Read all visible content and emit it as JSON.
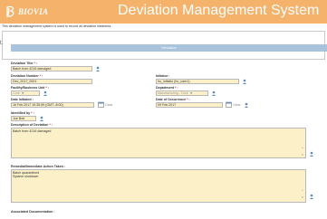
{
  "brand": {
    "logo_text": "BIOVIA"
  },
  "app": {
    "title": "Deviation Management System"
  },
  "intro_text": "This deviation management system is used to record all deviation instances.",
  "section": {
    "title": "Deviation"
  },
  "left_marker": "t.",
  "fields": {
    "deviation_title": {
      "label": "Deviation Title",
      "value": "Batch from 4216 damaged"
    },
    "deviation_number": {
      "label": "Deviation Number",
      "value": "Dev_2017_0001"
    },
    "initiator": {
      "label": "Initiator",
      "value": "hu_initiatio (hu_user1)"
    },
    "facility": {
      "label": "Facility/Business Unit",
      "value": "Cork"
    },
    "department": {
      "label": "Department",
      "value": "Manufacturing - Cork"
    },
    "date_initiated": {
      "label": "Date Initiated",
      "value": "16 Feb 2017 10:35:59 (GMT -8:00)",
      "clear_label": "Clear"
    },
    "date_of_occurrence": {
      "label": "Date of Occurrence",
      "value": "09 Feb 2017",
      "clear_label": "Clear"
    },
    "identified_by": {
      "label": "Identified by",
      "value": "Joe Bob"
    },
    "description": {
      "label": "Description of Deviation",
      "lines": [
        "Batch from 4216 damaged"
      ]
    },
    "remedial_action": {
      "label": "Remedial/Immediate Action Taken",
      "lines": [
        "Batch quarantined",
        "System shutdown"
      ]
    },
    "associated_documentation": {
      "label": "Associated Documentation"
    }
  },
  "required_mark": "*",
  "colors": {
    "header": "#f4b26a",
    "section_bar": "#a9c3dd",
    "field_bg": "#fbf0c8"
  },
  "icons": {
    "picker": "person-search-icon",
    "calendar": "calendar-icon"
  }
}
